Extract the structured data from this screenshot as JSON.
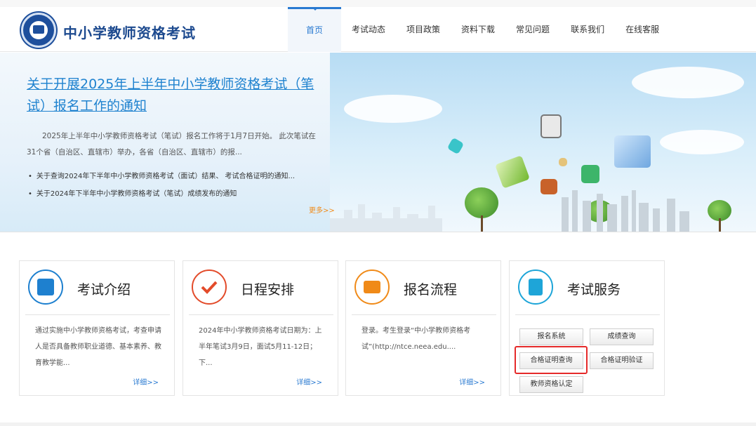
{
  "header": {
    "site_title": "中小学教师资格考试",
    "nav": [
      "首页",
      "考试动态",
      "项目政策",
      "资料下载",
      "常见问题",
      "联系我们",
      "在线客服"
    ]
  },
  "banner": {
    "headline": "关于开展2025年上半年中小学教师资格考试（笔试）报名工作的通知",
    "summary": "2025年上半年中小学教师资格考试（笔试）报名工作将于1月7日开始。 此次笔试在31个省（自治区、直辖市）举办，各省（自治区、直辖市）的报...",
    "news": [
      "关于查询2024年下半年中小学教师资格考试（面试）结果、 考试合格证明的通知...",
      "关于2024年下半年中小学教师资格考试（笔试）成绩发布的通知"
    ],
    "more": "更多>>"
  },
  "cards": [
    {
      "title": "考试介绍",
      "text": "通过实施中小学教师资格考试，考查申请人是否具备教师职业道德、基本素养、教育教学能...",
      "detail": "详细>>",
      "icon": "exam-intro-icon",
      "color": "#1e80cf"
    },
    {
      "title": "日程安排",
      "text": "2024年中小学教师资格考试日期为：上半年笔试3月9日，面试5月11-12日；下...",
      "detail": "详细>>",
      "icon": "check-icon",
      "color": "#e34b2a"
    },
    {
      "title": "报名流程",
      "text": "登录。考生登录“中小学教师资格考试”(http://ntce.neea.edu....",
      "detail": "详细>>",
      "icon": "registration-icon",
      "color": "#f08a18"
    },
    {
      "title": "考试服务",
      "icon": "contact-book-icon",
      "color": "#1ea5d8"
    }
  ],
  "services": [
    "报名系统",
    "成绩查询",
    "合格证明查询",
    "合格证明验证",
    "教师资格认定"
  ]
}
